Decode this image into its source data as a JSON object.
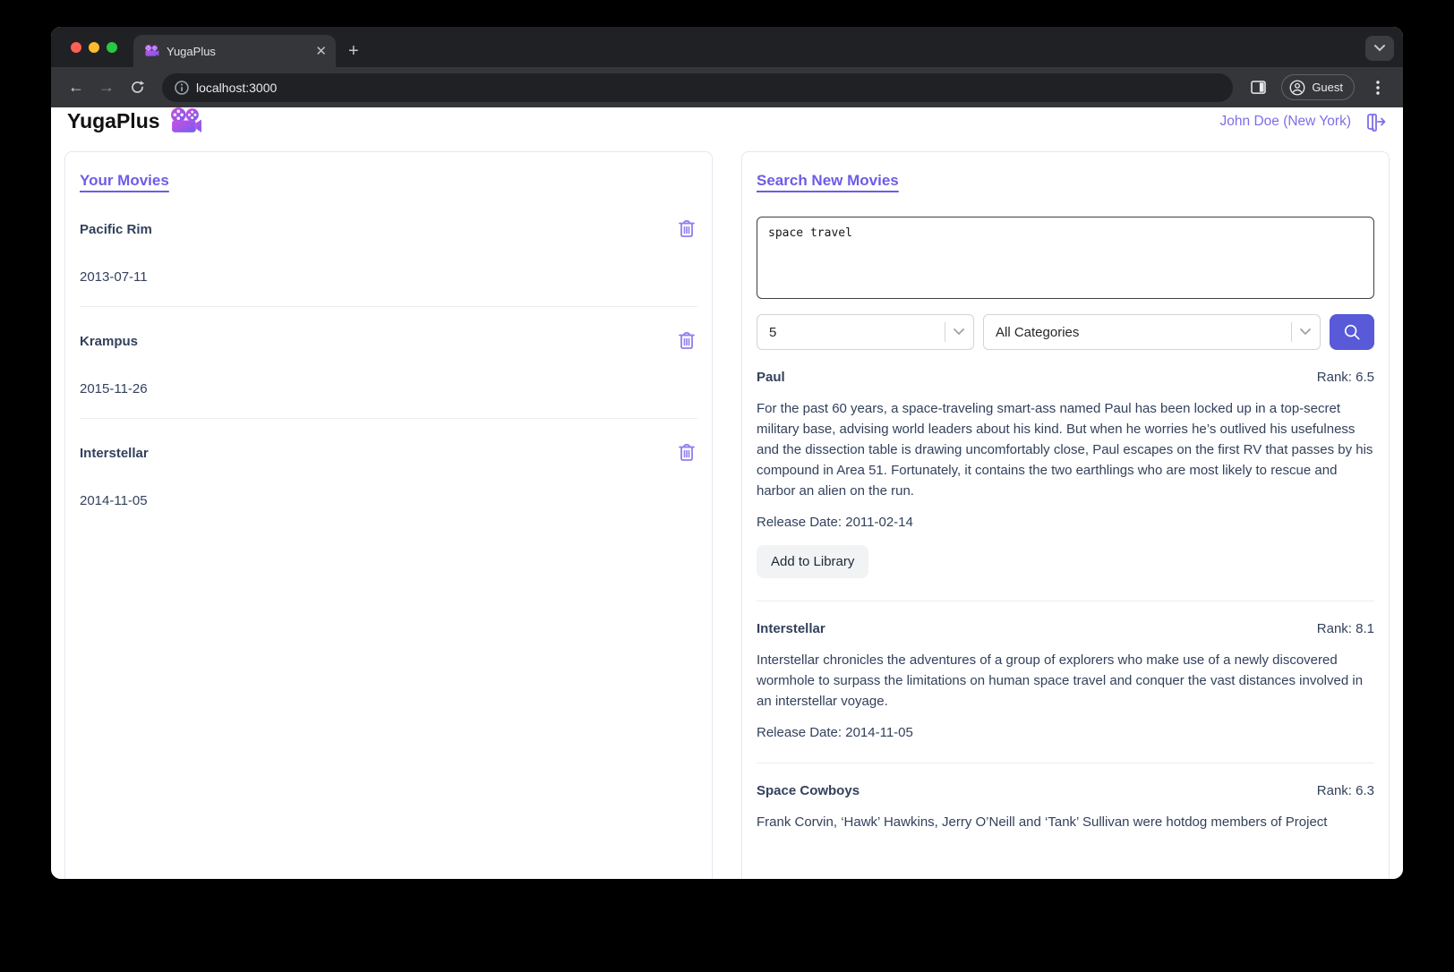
{
  "colors": {
    "accent": "#6c5ce7",
    "accent_light": "#8f7ef0",
    "button": "#585ad8",
    "ink": "#33415c"
  },
  "browser": {
    "tab_title": "YugaPlus",
    "url": "localhost:3000",
    "profile_label": "Guest"
  },
  "header": {
    "app_title": "YugaPlus",
    "user": "John Doe (New York)"
  },
  "library": {
    "title": "Your Movies",
    "movies": [
      {
        "name": "Pacific Rim",
        "date": "2013-07-11"
      },
      {
        "name": "Krampus",
        "date": "2015-11-26"
      },
      {
        "name": "Interstellar",
        "date": "2014-11-05"
      }
    ]
  },
  "search": {
    "title": "Search New Movies",
    "query": "space travel",
    "limit_value": "5",
    "category_value": "All Categories",
    "add_label": "Add to Library",
    "results": [
      {
        "name": "Paul",
        "rank": "Rank: 6.5",
        "description": "For the past 60 years, a space-traveling smart-ass named Paul has been locked up in a top-secret military base, advising world leaders about his kind. But when he worries he’s outlived his usefulness and the dissection table is drawing uncomfortably close, Paul escapes on the first RV that passes by his compound in Area 51. Fortunately, it contains the two earthlings who are most likely to rescue and harbor an alien on the run.",
        "release": "Release Date: 2011-02-14"
      },
      {
        "name": "Interstellar",
        "rank": "Rank: 8.1",
        "description": "Interstellar chronicles the adventures of a group of explorers who make use of a newly discovered wormhole to surpass the limitations on human space travel and conquer the vast distances involved in an interstellar voyage.",
        "release": "Release Date: 2014-11-05"
      },
      {
        "name": "Space Cowboys",
        "rank": "Rank: 6.3",
        "description": "Frank Corvin, ‘Hawk’ Hawkins, Jerry O’Neill and ‘Tank’ Sullivan were hotdog members of Project"
      }
    ]
  }
}
